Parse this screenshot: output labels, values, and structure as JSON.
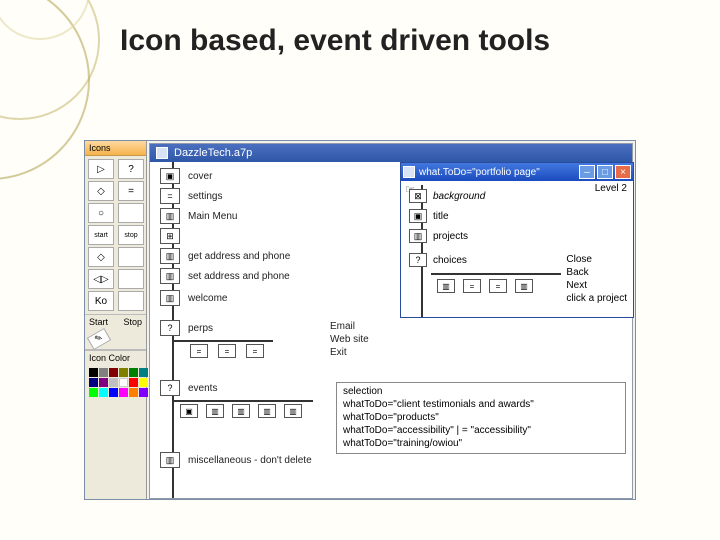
{
  "slide": {
    "title": "Icon based, event driven tools"
  },
  "toolbox": {
    "title": "Icons",
    "buttons": [
      "▷",
      "?",
      "◇",
      "=",
      "○",
      "",
      "start",
      "stop",
      "◇",
      "",
      "◁▷",
      "",
      "Ko",
      ""
    ],
    "start": "Start",
    "stop": "Stop",
    "palette_label": "Icon Color",
    "swatches": [
      "#000",
      "#808080",
      "#800000",
      "#808000",
      "#008000",
      "#008080",
      "#000080",
      "#800080",
      "#c0c0c0",
      "#ffffff",
      "#ff0000",
      "#ffff00",
      "#00ff00",
      "#00ffff",
      "#0000ff",
      "#ff00ff",
      "#ff8000",
      "#8000ff"
    ]
  },
  "design": {
    "title": "DazzleTech.a7p",
    "items": [
      {
        "label": "cover"
      },
      {
        "label": "settings"
      },
      {
        "label": "Main Menu"
      },
      {
        "label": ""
      },
      {
        "label": "get address and phone"
      },
      {
        "label": "set address and phone"
      },
      {
        "label": "welcome"
      },
      {
        "label": "perps"
      },
      {
        "label": "events"
      },
      {
        "label": "miscellaneous - don't delete"
      }
    ],
    "perps_outcomes": [
      "Email",
      "Web site",
      "Exit"
    ]
  },
  "child": {
    "title": "what.ToDo=\"portfolio page\"",
    "level": "Level 2",
    "items": [
      "background",
      "title",
      "projects",
      "choices"
    ],
    "outcomes": [
      "Close",
      "Back",
      "Next",
      "click a project"
    ]
  },
  "selection": {
    "header": "selection",
    "lines": [
      "whatToDo=\"client testimonials and awards\"",
      "whatToDo=\"products\"",
      "whatToDo=\"accessibility\" | = \"accessibility\"",
      "whatToDo=\"training/owiou\""
    ]
  },
  "win_buttons": {
    "min": "–",
    "max": "□",
    "close": "×"
  }
}
